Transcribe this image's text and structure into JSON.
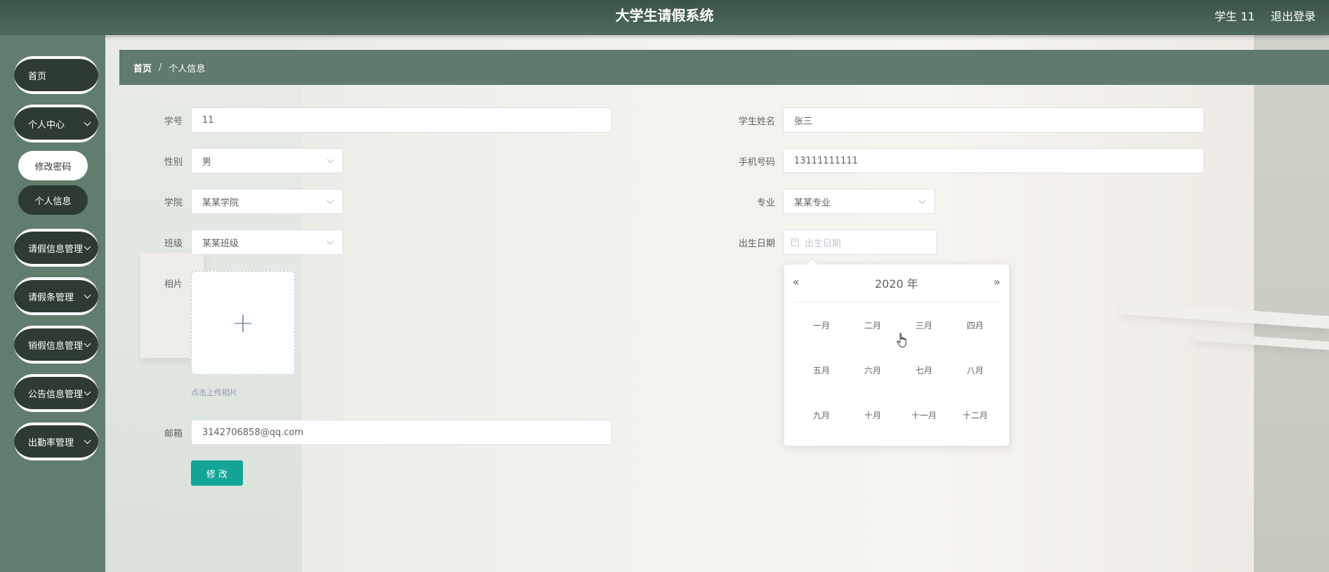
{
  "header": {
    "title": "大学生请假系统",
    "user": "学生 11",
    "logout": "退出登录"
  },
  "sidebar": {
    "items": [
      {
        "label": "首页",
        "has_submenu": false
      },
      {
        "label": "个人中心",
        "has_submenu": true
      },
      {
        "label": "请假信息管理",
        "has_submenu": true
      },
      {
        "label": "请假条管理",
        "has_submenu": true
      },
      {
        "label": "销假信息管理",
        "has_submenu": true
      },
      {
        "label": "公告信息管理",
        "has_submenu": true
      },
      {
        "label": "出勤率管理",
        "has_submenu": true
      }
    ],
    "subitems": [
      {
        "label": "修改密码"
      },
      {
        "label": "个人信息"
      }
    ]
  },
  "breadcrumb": {
    "home": "首页",
    "separator": "/",
    "current": "个人信息"
  },
  "form": {
    "student_id": {
      "label": "学号",
      "value": "11"
    },
    "student_name": {
      "label": "学生姓名",
      "value": "张三"
    },
    "gender": {
      "label": "性别",
      "value": "男"
    },
    "phone": {
      "label": "手机号码",
      "value": "13111111111"
    },
    "college": {
      "label": "学院",
      "value": "某某学院"
    },
    "major": {
      "label": "专业",
      "value": "某某专业"
    },
    "class": {
      "label": "班级",
      "value": "某某班级"
    },
    "birthdate": {
      "label": "出生日期",
      "placeholder": "出生日期"
    },
    "photo": {
      "label": "相片",
      "tip": "点击上传相片"
    },
    "email": {
      "label": "邮箱",
      "value": "3142706858@qq.com"
    },
    "submit": "修 改"
  },
  "datepicker": {
    "prev": "«",
    "next": "»",
    "year_label": "2020 年",
    "months": [
      "一月",
      "二月",
      "三月",
      "四月",
      "五月",
      "六月",
      "七月",
      "八月",
      "九月",
      "十月",
      "十一月",
      "十二月"
    ]
  },
  "colors": {
    "header_bg": "#4a6455",
    "sidebar_bg": "#617d6e",
    "menu_pill": "#2e3b32",
    "breadcrumb_bg": "#607a6b",
    "primary_button": "#15a596"
  }
}
